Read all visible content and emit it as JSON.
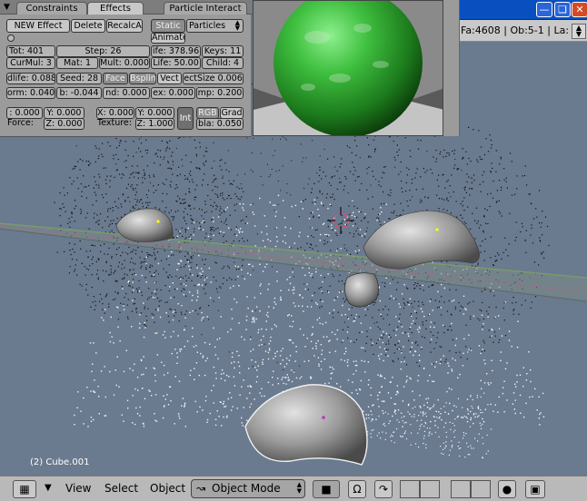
{
  "window": {
    "minimize_icon": "minimize-icon",
    "maximize_icon": "maximize-icon",
    "close_icon": "close-icon",
    "status_text": "Fa:4608 | Ob:5-1 | La:"
  },
  "panel": {
    "tabs": [
      "Constraints",
      "Effects",
      "Particle Interact"
    ],
    "active_tab": "Effects",
    "new_effect": "NEW Effect",
    "delete": "Delete",
    "recalc": "RecalcA",
    "static": "Static",
    "particles": "Particles",
    "animate": "Animate",
    "row1": [
      "Tot: 401",
      "Step: 26",
      "ife: 378.96",
      "Keys: 11"
    ],
    "row2": [
      "CurMul: 3",
      "Mat: 1",
      "Mult: 0.000",
      "Life: 50.00",
      "Child: 4"
    ],
    "row3": [
      "dlife: 0.088",
      "Seed: 28",
      "Face",
      "Bsplin",
      "Vect",
      "ectSize 0.006"
    ],
    "row4": [
      "orm: 0.040",
      "b: -0.044",
      "nd: 0.000",
      "ex: 0.000",
      "mp: 0.200"
    ],
    "force_block": {
      "x": ": 0.000",
      "y": "Y: 0.000",
      "label": "Force:",
      "z": "Z: 0.000"
    },
    "texture_block": {
      "x": "X: 0.000",
      "y": "Y: 0.000",
      "label": "Texture:",
      "z": "Z: 1.000"
    },
    "int": "Int",
    "rgb": "RGB",
    "grad": "Grad",
    "bla": "bla: 0.050"
  },
  "viewport": {
    "object_label": "(2) Cube.001"
  },
  "header": {
    "menus": [
      "View",
      "Select",
      "Object"
    ],
    "mode": "Object Mode"
  },
  "colors": {
    "viewport_bg": "#6a7a8f",
    "panel_bg": "#9b9b9b",
    "titlebar": "#0a4fc0"
  }
}
